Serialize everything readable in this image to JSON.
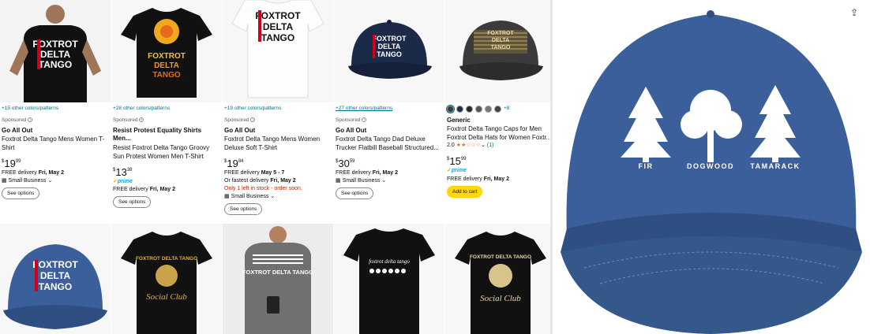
{
  "products": [
    {
      "colors": "+15 other colors/patterns",
      "sponsored": "Sponsored",
      "brand": "Go All Out",
      "title": "Foxtrot Delta Tango Mens Women T-Shirt",
      "price_whole": "19",
      "price_frac": "99",
      "delivery_pre": "FREE delivery ",
      "delivery_date": "Fri, May 2",
      "small_business": "Small Business",
      "button": "See options",
      "shirt_text": [
        "FOXTROT",
        "DELTA",
        "TANGO"
      ]
    },
    {
      "colors": "+28 other colors/patterns",
      "sponsored": "Sponsored",
      "brand": "Resist Protest Equality Shirts Men...",
      "title": "Resist Foxtrot Delta Tango Groovy Sun Protest Women Men T-Shirt",
      "price_whole": "13",
      "price_frac": "38",
      "prime": "prime",
      "delivery_pre": "FREE delivery ",
      "delivery_date": "Fri, May 2",
      "button": "See options",
      "shirt_text": [
        "FOXTROT",
        "DELTA",
        "TANGO"
      ]
    },
    {
      "colors": "+19 other colors/patterns",
      "sponsored": "Sponsored",
      "brand": "Go All Out",
      "title": "Foxtrot Delta Tango Mens Women Deluxe Soft T-Shirt",
      "price_whole": "19",
      "price_frac": "84",
      "delivery_pre": "FREE delivery ",
      "delivery_date": "May 5 - 7",
      "fastest_pre": "Or fastest delivery ",
      "fastest_date": "Fri, May 2",
      "stock": "Only 1 left in stock - order soon.",
      "small_business": "Small Business",
      "button": "See options",
      "shirt_text": [
        "FOXTROT",
        "DELTA",
        "TANGO"
      ]
    },
    {
      "colors": "+27 other colors/patterns",
      "sponsored": "Sponsored",
      "brand": "Go All Out",
      "title": "Foxtrot Delta Tango Dad Deluxe Trucker Flatbill Baseball Structured...",
      "price_whole": "30",
      "price_frac": "59",
      "delivery_pre": "FREE delivery ",
      "delivery_date": "Fri, May 2",
      "small_business": "Small Business",
      "button": "See options",
      "shirt_text": [
        "FOXTROT",
        "DELTA",
        "TANGO"
      ]
    },
    {
      "more_swatches": "+8",
      "brand": "Generic",
      "title": "Foxtrot Delta Tango Caps for Men Foxtrot Delta Hats for Women Foxtr...",
      "rating": "2.0",
      "stars": "★★☆☆☆",
      "reviews": "(1)",
      "price_whole": "15",
      "price_frac": "99",
      "prime": "prime",
      "delivery_pre": "FREE delivery ",
      "delivery_date": "Fri, May 2",
      "button": "Add to cart",
      "shirt_text": [
        "FOXTROT",
        "DELTA",
        "TANGO"
      ]
    }
  ],
  "row2": [
    {
      "shirt_text": [
        "FOXTROT",
        "DELTA",
        "TANGO"
      ]
    },
    {
      "shirt_text": [
        "FOXTROT DELTA TANGO",
        "Social Club"
      ]
    },
    {
      "shirt_text": [
        "FOXTROT DELTA TANGO"
      ]
    },
    {
      "shirt_text": [
        "foxtrot delta tango"
      ]
    },
    {
      "shirt_text": [
        "FOXTROT DELTA TANGO",
        "Social Club"
      ]
    }
  ],
  "hero": {
    "tree_labels": [
      "FIR",
      "DOGWOOD",
      "TAMARACK"
    ],
    "share_icon": "share-icon"
  },
  "colors": {
    "link": "#007185",
    "red": "#b12704",
    "button_yellow": "#ffd814",
    "denim": "#3a5f9a"
  }
}
